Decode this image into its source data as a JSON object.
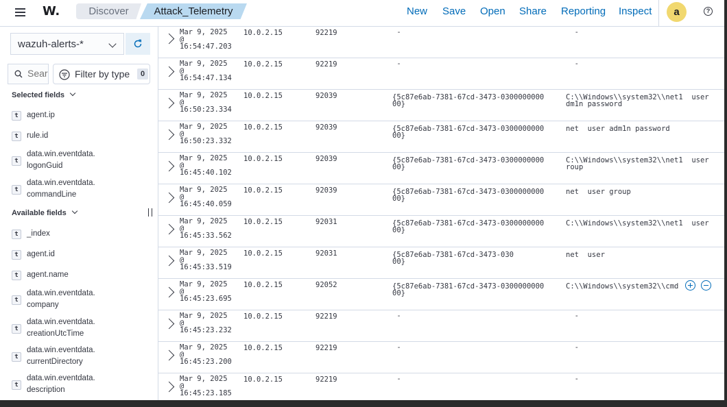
{
  "header": {
    "logo": "W.",
    "breadcrumbs": [
      "Discover",
      "Attack_Telemetry"
    ],
    "nav": [
      "New",
      "Save",
      "Open",
      "Share",
      "Reporting",
      "Inspect"
    ],
    "avatar": "a",
    "help": "?"
  },
  "sidebar": {
    "index_pattern": "wazuh-alerts-*",
    "search_placeholder": "Search field names",
    "filter_label": "Filter by type",
    "filter_count": "0",
    "selected_title": "Selected fields",
    "selected_fields": [
      {
        "type": "t",
        "name": "agent.ip"
      },
      {
        "type": "t",
        "name": "rule.id"
      },
      {
        "type": "t",
        "name": "data.win.eventdata.\nlogonGuid"
      },
      {
        "type": "t",
        "name": "data.win.eventdata.\ncommandLine"
      }
    ],
    "available_title": "Available fields",
    "available_fields": [
      {
        "type": "t",
        "name": "_index"
      },
      {
        "type": "t",
        "name": "agent.id"
      },
      {
        "type": "t",
        "name": "agent.name"
      },
      {
        "type": "t",
        "name": "data.win.eventdata.\ncompany"
      },
      {
        "type": "t",
        "name": "data.win.eventdata.\ncreationUtcTime"
      },
      {
        "type": "t",
        "name": "data.win.eventdata.\ncurrentDirectory"
      },
      {
        "type": "t",
        "name": "data.win.eventdata.\ndescription"
      }
    ]
  },
  "rows": [
    {
      "ts": "Mar 9, 2025\n@\n16:54:47.203",
      "ip": "10.0.2.15",
      "rule": "92219",
      "guid": " -",
      "cmd": "  -"
    },
    {
      "ts": "Mar 9, 2025\n@\n16:54:47.134",
      "ip": "10.0.2.15",
      "rule": "92219",
      "guid": " -",
      "cmd": "  -"
    },
    {
      "ts": "Mar 9, 2025\n@\n16:50:23.334",
      "ip": "10.0.2.15",
      "rule": "92039",
      "guid": "{5c87e6ab-7381-67cd-3473-0300000000\n00}",
      "cmd": "C:\\\\Windows\\\\system32\\\\net1  user\ndm1n password"
    },
    {
      "ts": "Mar 9, 2025\n@\n16:50:23.332",
      "ip": "10.0.2.15",
      "rule": "92039",
      "guid": "{5c87e6ab-7381-67cd-3473-0300000000\n00}",
      "cmd": "net  user adm1n password"
    },
    {
      "ts": "Mar 9, 2025\n@\n16:45:40.102",
      "ip": "10.0.2.15",
      "rule": "92039",
      "guid": "{5c87e6ab-7381-67cd-3473-0300000000\n00}",
      "cmd": "C:\\\\Windows\\\\system32\\\\net1  user\nroup"
    },
    {
      "ts": "Mar 9, 2025\n@\n16:45:40.059",
      "ip": "10.0.2.15",
      "rule": "92039",
      "guid": "{5c87e6ab-7381-67cd-3473-0300000000\n00}",
      "cmd": "net  user group"
    },
    {
      "ts": "Mar 9, 2025\n@\n16:45:33.562",
      "ip": "10.0.2.15",
      "rule": "92031",
      "guid": "{5c87e6ab-7381-67cd-3473-0300000000\n00}",
      "cmd": "C:\\\\Windows\\\\system32\\\\net1  user"
    },
    {
      "ts": "Mar 9, 2025\n@\n16:45:33.519",
      "ip": "10.0.2.15",
      "rule": "92031",
      "guid": "{5c87e6ab-7381-67cd-3473-030\n00}",
      "cmd": "net  user"
    },
    {
      "ts": "Mar 9, 2025\n@\n16:45:23.695",
      "ip": "10.0.2.15",
      "rule": "92052",
      "guid": "{5c87e6ab-7381-67cd-3473-0300000000\n00}",
      "cmd": "C:\\\\Windows\\\\system32\\\\cmd.exe"
    },
    {
      "ts": "Mar 9, 2025\n@\n16:45:23.232",
      "ip": "10.0.2.15",
      "rule": "92219",
      "guid": " -",
      "cmd": "  -"
    },
    {
      "ts": "Mar 9, 2025\n@\n16:45:23.200",
      "ip": "10.0.2.15",
      "rule": "92219",
      "guid": " -",
      "cmd": "  -"
    },
    {
      "ts": "Mar 9, 2025\n@\n16:45:23.185",
      "ip": "10.0.2.15",
      "rule": "92219",
      "guid": " -",
      "cmd": "  -"
    }
  ]
}
